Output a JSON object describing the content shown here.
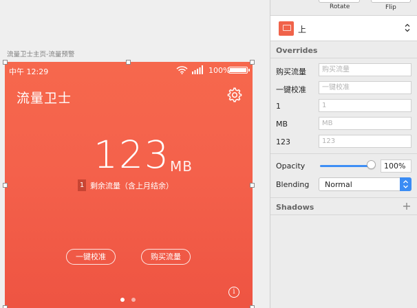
{
  "canvas": {
    "artboard_label": "流量卫士主页-流量预警"
  },
  "phone": {
    "status_time": "中午 12:29",
    "battery_percent": "100%",
    "app_title": "流量卫士",
    "big_number": "123",
    "unit": "MB",
    "remaining_badge": "1",
    "remaining_text": "剩余流量（含上月结余）",
    "calibrate_label": "一键校准",
    "buy_label": "购买流量",
    "info_glyph": "i",
    "page_dots": 2,
    "current_page": 1,
    "background_color": "#f4614b"
  },
  "inspector": {
    "rotate_label": "Rotate",
    "flip_label": "Flip",
    "symbol_name": "上",
    "overrides_title": "Overrides",
    "overrides": [
      {
        "label": "购买流量",
        "placeholder": "购买流量"
      },
      {
        "label": "一键校准",
        "placeholder": "一键校准"
      },
      {
        "label": "1",
        "placeholder": "1"
      },
      {
        "label": "MB",
        "placeholder": "MB"
      },
      {
        "label": "123",
        "placeholder": "123"
      }
    ],
    "opacity_label": "Opacity",
    "opacity_value": "100%",
    "opacity_level": 1.0,
    "blending_label": "Blending",
    "blending_value": "Normal",
    "shadows_title": "Shadows",
    "accent_color": "#3d8ef5"
  }
}
